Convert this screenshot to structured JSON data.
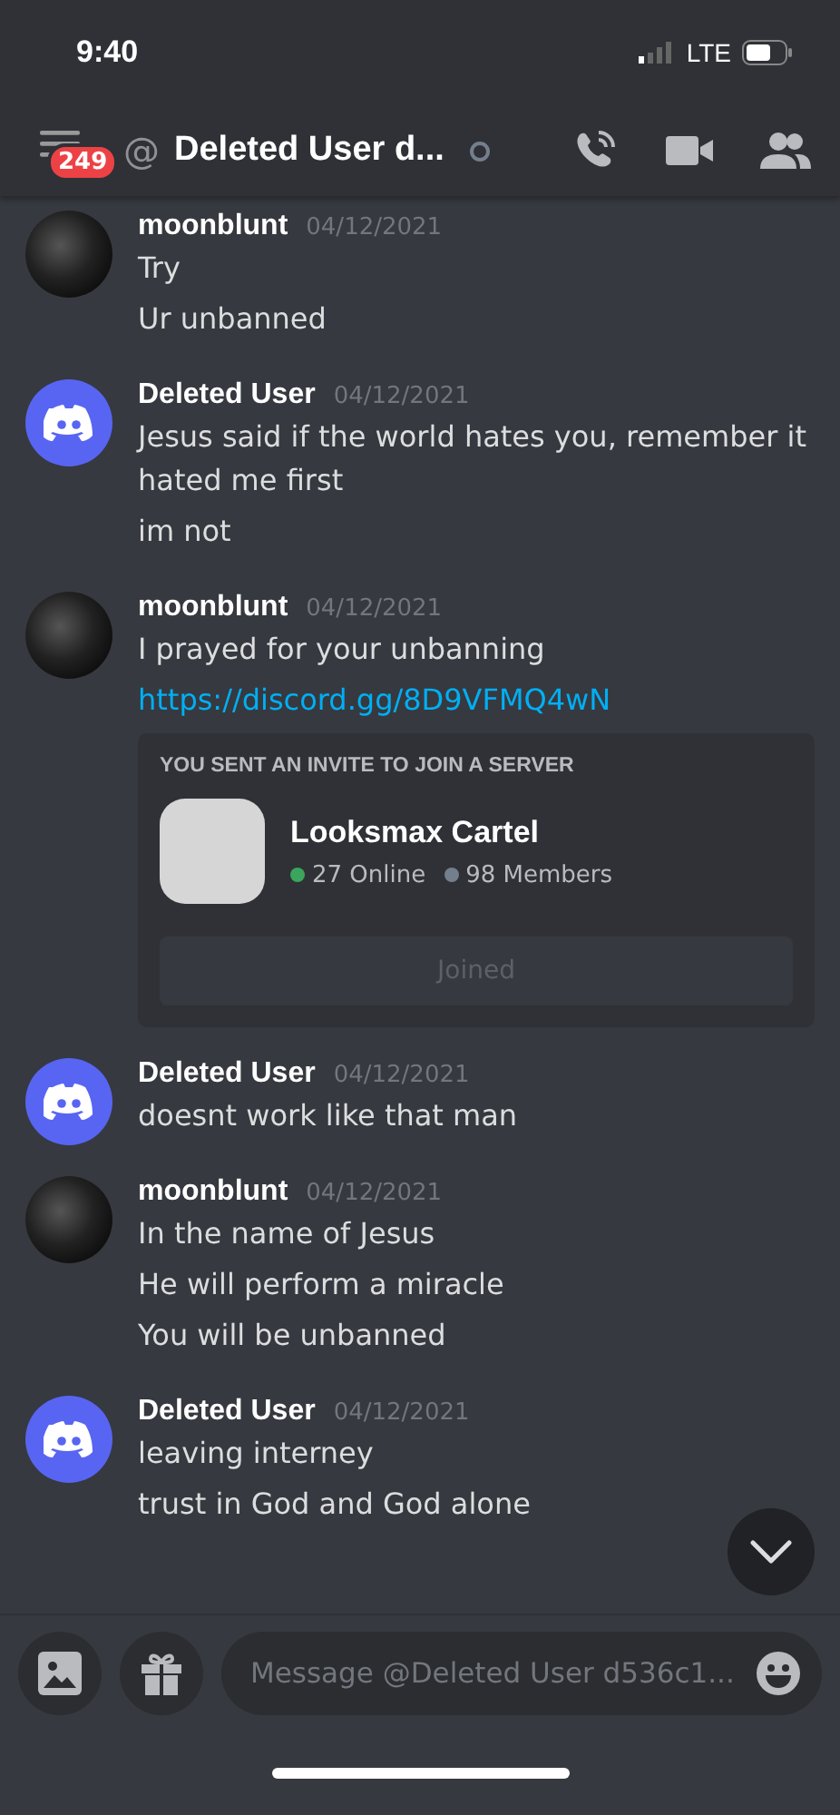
{
  "status_bar": {
    "time": "9:40",
    "network": "LTE"
  },
  "header": {
    "badge": "249",
    "prefix": "@",
    "title": "Deleted User d...",
    "online": false
  },
  "messages": [
    {
      "author": "moonblunt",
      "date": "04/12/2021",
      "kind": "photo",
      "lines": [
        {
          "kind": "text",
          "text": "Try"
        },
        {
          "kind": "text",
          "text": "Ur unbanned"
        }
      ]
    },
    {
      "author": "Deleted User",
      "date": "04/12/2021",
      "kind": "discord",
      "lines": [
        {
          "kind": "text",
          "text": "Jesus said if the world hates you, remember it hated me first"
        },
        {
          "kind": "text",
          "text": "im not"
        }
      ]
    },
    {
      "author": "moonblunt",
      "date": "04/12/2021",
      "kind": "photo",
      "lines": [
        {
          "kind": "text",
          "text": "I prayed for your unbanning"
        },
        {
          "kind": "link",
          "text": "https://discord.gg/8D9VFMQ4wN"
        }
      ],
      "invite": {
        "heading": "YOU SENT AN INVITE TO JOIN A SERVER",
        "server": "Looksmax Cartel",
        "online": "27 Online",
        "members": "98 Members",
        "button": "Joined",
        "joined": true
      }
    },
    {
      "author": "Deleted User",
      "date": "04/12/2021",
      "kind": "discord",
      "lines": [
        {
          "kind": "text",
          "text": "doesnt work like that man"
        }
      ]
    },
    {
      "author": "moonblunt",
      "date": "04/12/2021",
      "kind": "photo",
      "lines": [
        {
          "kind": "text",
          "text": "In the name of Jesus"
        },
        {
          "kind": "text",
          "text": "He will perform a miracle"
        },
        {
          "kind": "text",
          "text": "You will be unbanned"
        }
      ]
    },
    {
      "author": "Deleted User",
      "date": "04/12/2021",
      "kind": "discord",
      "lines": [
        {
          "kind": "text",
          "text": "leaving interney"
        },
        {
          "kind": "text",
          "text": "trust in God and God alone"
        }
      ]
    }
  ],
  "composer": {
    "placeholder": "Message @Deleted User d536c1..."
  }
}
